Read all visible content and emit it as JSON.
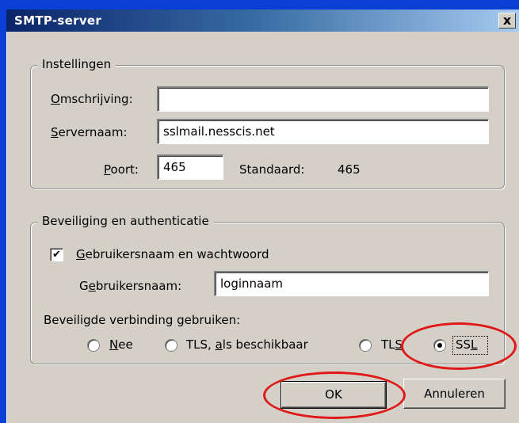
{
  "window": {
    "title": "SMTP-server",
    "close_glyph": "x"
  },
  "settings": {
    "legend": "Instellingen",
    "description_label_accel": "O",
    "description_label_rest": "mschrijving:",
    "description_value": "",
    "server_label_accel": "S",
    "server_label_rest": "ervernaam:",
    "server_value": "sslmail.nesscis.net",
    "port_label_accel": "P",
    "port_label_rest": "oort:",
    "port_value": "465",
    "default_label": "Standaard:",
    "default_value": "465"
  },
  "security": {
    "legend": "Beveiliging en authenticatie",
    "use_auth_checked": true,
    "use_auth_check_glyph": "✔",
    "use_auth_label_accel": "G",
    "use_auth_label_rest": "ebruikersnaam en wachtwoord",
    "username_label_pre": "G",
    "username_label_accel": "e",
    "username_label_rest": "bruikersnaam:",
    "username_value": "loginnaam",
    "secure_conn_label": "Beveiligde verbinding gebruiken:",
    "options": {
      "none_accel": "N",
      "none_rest": "ee",
      "tls_avail_pre": "TLS, ",
      "tls_avail_accel": "a",
      "tls_avail_rest": "ls beschikbaar",
      "tls_pre": "TL",
      "tls_accel": "S",
      "ssl_pre": "SS",
      "ssl_accel": "L"
    },
    "selected": "SSL"
  },
  "buttons": {
    "ok": "OK",
    "cancel": "Annuleren"
  },
  "colors": {
    "desktop": "#0a3fd6",
    "dialog": "#d4d0c8",
    "annotation": "#e01818"
  }
}
